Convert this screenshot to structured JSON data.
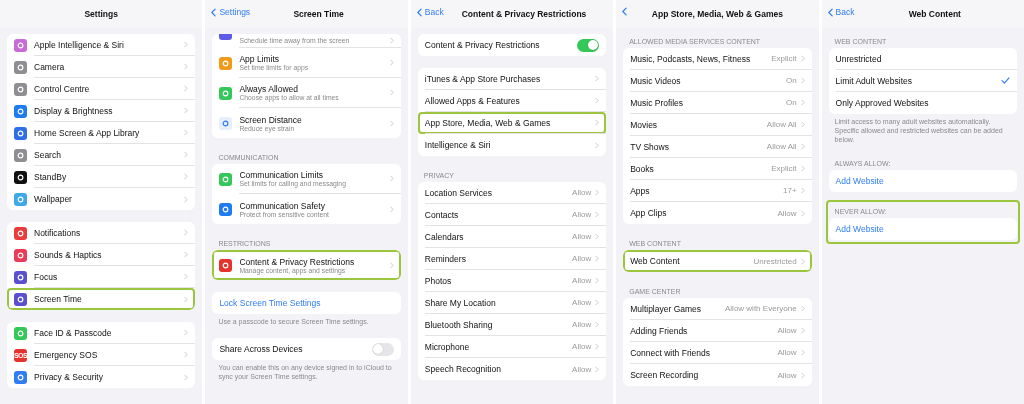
{
  "panels": [
    {
      "nav": {
        "title": "Settings"
      },
      "sections": [
        {
          "highlighted": false,
          "rows": [
            {
              "kind": "nav",
              "title": "Apple Intelligence & Siri",
              "color": "#c86bd8",
              "highlighted": false
            },
            {
              "kind": "nav",
              "title": "Camera",
              "color": "#8e8e93",
              "highlighted": false
            },
            {
              "kind": "nav",
              "title": "Control Centre",
              "color": "#8e8e93",
              "highlighted": false
            },
            {
              "kind": "nav",
              "title": "Display & Brightness",
              "color": "#1e7cf0",
              "highlighted": false
            },
            {
              "kind": "nav",
              "title": "Home Screen & App Library",
              "color": "#2f6fe6",
              "highlighted": false
            },
            {
              "kind": "nav",
              "title": "Search",
              "color": "#8e8e93",
              "highlighted": false
            },
            {
              "kind": "nav",
              "title": "StandBy",
              "color": "#111111",
              "highlighted": false
            },
            {
              "kind": "nav",
              "title": "Wallpaper",
              "color": "#3fa9e8",
              "highlighted": false
            }
          ]
        },
        {
          "highlighted": false,
          "rows": [
            {
              "kind": "nav",
              "title": "Notifications",
              "color": "#ea3b3b",
              "highlighted": false
            },
            {
              "kind": "nav",
              "title": "Sounds & Haptics",
              "color": "#ea3b59",
              "highlighted": false
            },
            {
              "kind": "nav",
              "title": "Focus",
              "color": "#5a4fcf",
              "highlighted": false
            },
            {
              "kind": "nav",
              "title": "Screen Time",
              "color": "#5a4fcf",
              "highlighted": true
            }
          ]
        },
        {
          "highlighted": false,
          "rows": [
            {
              "kind": "nav",
              "title": "Face ID & Passcode",
              "color": "#34c759",
              "highlighted": false
            },
            {
              "kind": "nav",
              "title": "Emergency SOS",
              "color": "#e5322d",
              "icon_text": "SOS",
              "highlighted": false
            },
            {
              "kind": "nav",
              "title": "Privacy & Security",
              "color": "#2f7cf6",
              "highlighted": false
            }
          ]
        }
      ]
    },
    {
      "nav": {
        "back": "Settings",
        "title": "Screen Time"
      },
      "sections": [
        {
          "highlighted": false,
          "rows": [
            {
              "kind": "nav",
              "subtitle": "Schedule time away from the screen",
              "color": "#5e5ce6",
              "highlighted": false
            },
            {
              "kind": "nav",
              "title": "App Limits",
              "subtitle": "Set time limits for apps",
              "color": "#f09a1a",
              "highlighted": false
            },
            {
              "kind": "nav",
              "title": "Always Allowed",
              "subtitle": "Choose apps to allow at all times",
              "color": "#34c759",
              "highlighted": false
            },
            {
              "kind": "nav",
              "title": "Screen Distance",
              "subtitle": "Reduce eye strain",
              "color": "#e6effb",
              "highlighted": false
            }
          ]
        },
        {
          "header": "COMMUNICATION",
          "highlighted": false,
          "rows": [
            {
              "kind": "nav",
              "title": "Communication Limits",
              "subtitle": "Set limits for calling and messaging",
              "color": "#34c759",
              "highlighted": false
            },
            {
              "kind": "nav",
              "title": "Communication Safety",
              "subtitle": "Protect from sensitive content",
              "color": "#1e7cf0",
              "highlighted": false
            }
          ]
        },
        {
          "header": "RESTRICTIONS",
          "highlighted": false,
          "rows": [
            {
              "kind": "nav",
              "title": "Content & Privacy Restrictions",
              "subtitle": "Manage content, apps and settings",
              "color": "#e5322d",
              "highlighted": true
            }
          ]
        },
        {
          "highlighted": false,
          "rows": [
            {
              "kind": "link",
              "title": "Lock Screen Time Settings",
              "highlighted": false
            }
          ],
          "footer": "Use a passcode to secure Screen Time settings."
        },
        {
          "highlighted": false,
          "rows": [
            {
              "kind": "toggle",
              "title": "Share Across Devices",
              "on": false,
              "highlighted": false
            }
          ],
          "footer": "You can enable this on any device signed in to iCloud to sync your Screen Time settings."
        }
      ]
    },
    {
      "nav": {
        "back": "Back",
        "title": "Content & Privacy Restrictions"
      },
      "sections": [
        {
          "highlighted": false,
          "rows": [
            {
              "kind": "toggle",
              "title": "Content & Privacy Restrictions",
              "on": true,
              "highlighted": false
            }
          ]
        },
        {
          "highlighted": false,
          "rows": [
            {
              "kind": "nav",
              "title": "iTunes & App Store Purchases",
              "highlighted": false
            },
            {
              "kind": "nav",
              "title": "Allowed Apps & Features",
              "highlighted": false
            },
            {
              "kind": "nav",
              "title": "App Store, Media, Web & Games",
              "highlighted": true
            },
            {
              "kind": "nav",
              "title": "Intelligence & Siri",
              "highlighted": false
            }
          ]
        },
        {
          "header": "PRIVACY",
          "highlighted": false,
          "rows": [
            {
              "kind": "nav",
              "title": "Location Services",
              "value": "Allow",
              "highlighted": false
            },
            {
              "kind": "nav",
              "title": "Contacts",
              "value": "Allow",
              "highlighted": false
            },
            {
              "kind": "nav",
              "title": "Calendars",
              "value": "Allow",
              "highlighted": false
            },
            {
              "kind": "nav",
              "title": "Reminders",
              "value": "Allow",
              "highlighted": false
            },
            {
              "kind": "nav",
              "title": "Photos",
              "value": "Allow",
              "highlighted": false
            },
            {
              "kind": "nav",
              "title": "Share My Location",
              "value": "Allow",
              "highlighted": false
            },
            {
              "kind": "nav",
              "title": "Bluetooth Sharing",
              "value": "Allow",
              "highlighted": false
            },
            {
              "kind": "nav",
              "title": "Microphone",
              "value": "Allow",
              "highlighted": false
            },
            {
              "kind": "nav",
              "title": "Speech Recognition",
              "value": "Allow",
              "highlighted": false
            }
          ]
        }
      ]
    },
    {
      "nav": {
        "back_icon_only": true,
        "title": "App Store, Media, Web & Games"
      },
      "sections": [
        {
          "header": "ALLOWED MEDIA SERVICES CONTENT",
          "highlighted": false,
          "rows": [
            {
              "kind": "nav",
              "title": "Music, Podcasts, News, Fitness",
              "value": "Explicit",
              "highlighted": false
            },
            {
              "kind": "nav",
              "title": "Music Videos",
              "value": "On",
              "highlighted": false
            },
            {
              "kind": "nav",
              "title": "Music Profiles",
              "value": "On",
              "highlighted": false
            },
            {
              "kind": "nav",
              "title": "Movies",
              "value": "Allow All",
              "highlighted": false
            },
            {
              "kind": "nav",
              "title": "TV Shows",
              "value": "Allow All",
              "highlighted": false
            },
            {
              "kind": "nav",
              "title": "Books",
              "value": "Explicit",
              "highlighted": false
            },
            {
              "kind": "nav",
              "title": "Apps",
              "value": "17+",
              "highlighted": false
            },
            {
              "kind": "nav",
              "title": "App Clips",
              "value": "Allow",
              "highlighted": false
            }
          ]
        },
        {
          "header": "WEB CONTENT",
          "highlighted": false,
          "rows": [
            {
              "kind": "nav",
              "title": "Web Content",
              "value": "Unrestricted",
              "highlighted": true
            }
          ]
        },
        {
          "header": "GAME CENTER",
          "highlighted": false,
          "rows": [
            {
              "kind": "nav",
              "title": "Multiplayer Games",
              "value": "Allow with Everyone",
              "highlighted": false
            },
            {
              "kind": "nav",
              "title": "Adding Friends",
              "value": "Allow",
              "highlighted": false
            },
            {
              "kind": "nav",
              "title": "Connect with Friends",
              "value": "Allow",
              "highlighted": false
            },
            {
              "kind": "nav",
              "title": "Screen Recording",
              "value": "Allow",
              "highlighted": false
            }
          ]
        }
      ]
    },
    {
      "nav": {
        "back": "Back",
        "title": "Web Content"
      },
      "sections": [
        {
          "header": "WEB CONTENT",
          "highlighted": false,
          "rows": [
            {
              "kind": "option",
              "title": "Unrestricted",
              "selected": false,
              "highlighted": false
            },
            {
              "kind": "option",
              "title": "Limit Adult Websites",
              "selected": true,
              "highlighted": false
            },
            {
              "kind": "option",
              "title": "Only Approved Websites",
              "selected": false,
              "highlighted": false
            }
          ],
          "footer": "Limit access to many adult websites automatically. Specific allowed and restricted websites can be added below."
        },
        {
          "header": "ALWAYS ALLOW:",
          "highlighted": false,
          "rows": [
            {
              "kind": "link",
              "title": "Add Website",
              "highlighted": false
            }
          ]
        },
        {
          "header": "NEVER ALLOW:",
          "highlighted": true,
          "rows": [
            {
              "kind": "link",
              "title": "Add Website",
              "highlighted": false
            }
          ]
        }
      ]
    }
  ]
}
